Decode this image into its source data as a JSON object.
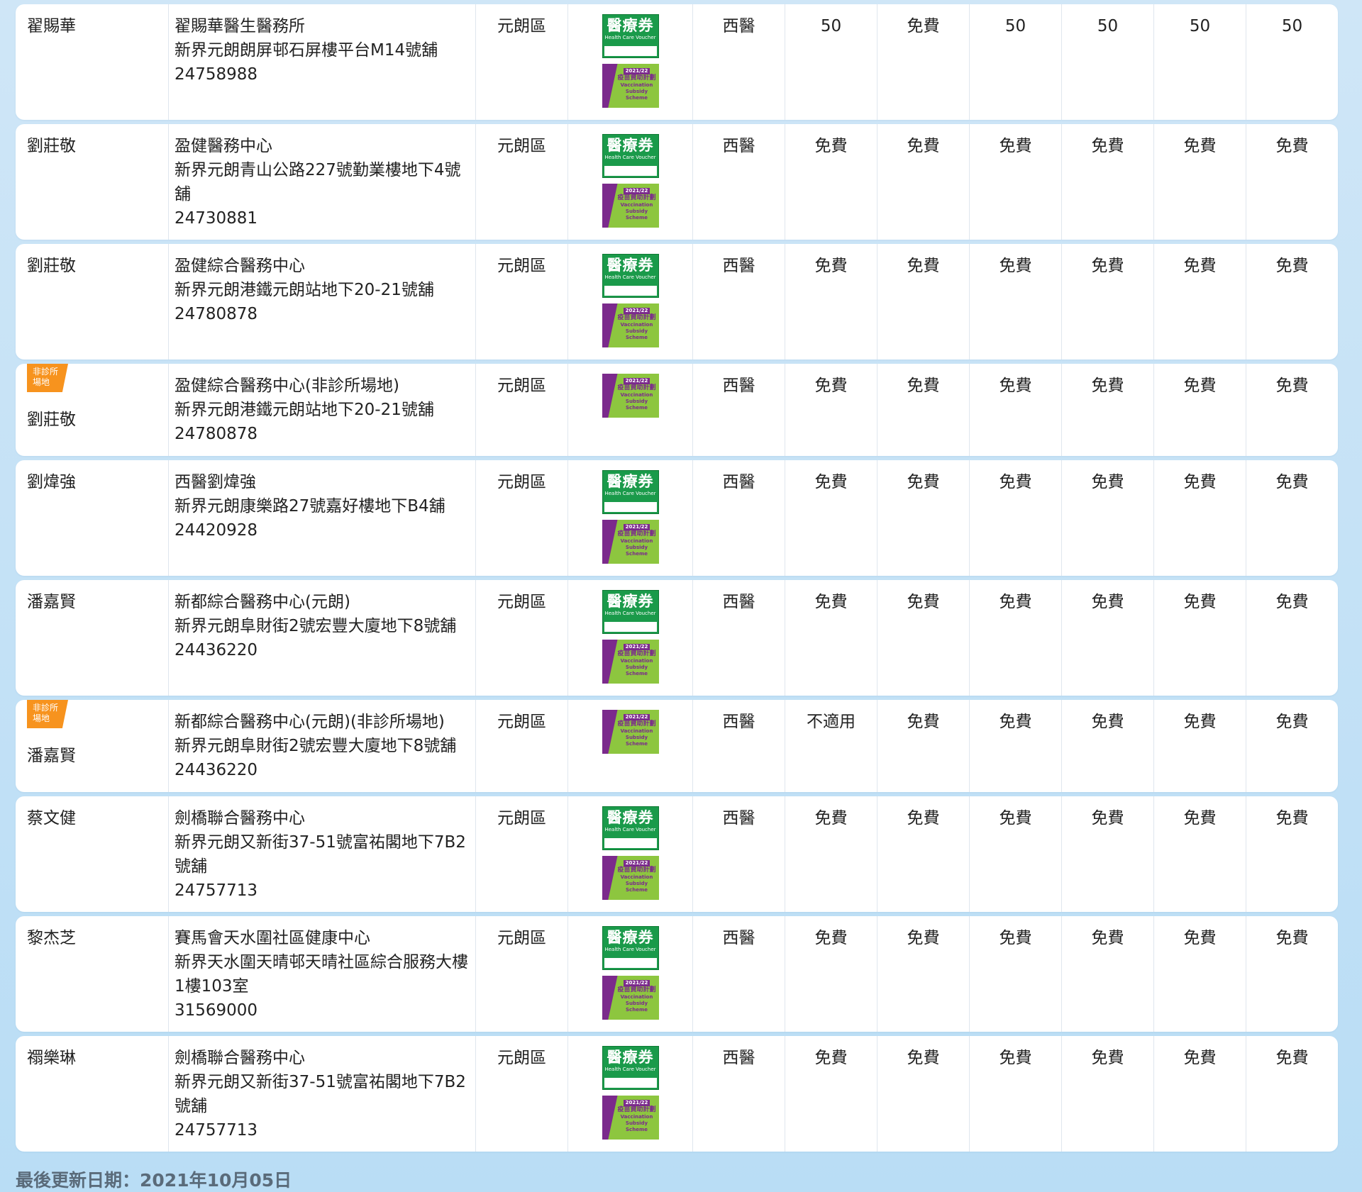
{
  "logos": {
    "hcv": {
      "name_zh": "醫療券",
      "name_en": "Health Care Voucher"
    },
    "vss": {
      "year": "2021/22",
      "name_zh": "疫苗資助計劃",
      "name_en": "Vaccination Subsidy Scheme"
    }
  },
  "tag": {
    "line1": "非診所",
    "line2": "場地"
  },
  "rows": [
    {
      "doctor": "翟賜華",
      "clinic": "翟賜華醫生醫務所",
      "address": "新界元朗朗屏邨石屏樓平台M14號舖",
      "phone": "24758988",
      "district": "元朗區",
      "type": "西醫",
      "fees": [
        "50",
        "免費",
        "50",
        "50",
        "50",
        "50"
      ]
    },
    {
      "doctor": "劉莊敬",
      "clinic": "盈健醫務中心",
      "address": "新界元朗青山公路227號勤業樓地下4號舖",
      "phone": "24730881",
      "district": "元朗區",
      "type": "西醫",
      "fees": [
        "免費",
        "免費",
        "免費",
        "免費",
        "免費",
        "免費"
      ]
    },
    {
      "doctor": "劉莊敬",
      "clinic": "盈健綜合醫務中心",
      "address": "新界元朗港鐵元朗站地下20-21號舖",
      "phone": "24780878",
      "district": "元朗區",
      "type": "西醫",
      "fees": [
        "免費",
        "免費",
        "免費",
        "免費",
        "免費",
        "免費"
      ]
    },
    {
      "doctor": "劉莊敬",
      "clinic": "盈健綜合醫務中心(非診所場地)",
      "address": "新界元朗港鐵元朗站地下20-21號舖",
      "phone": "24780878",
      "district": "元朗區",
      "type": "西醫",
      "fees": [
        "免費",
        "免費",
        "免費",
        "免費",
        "免費",
        "免費"
      ]
    },
    {
      "doctor": "劉煒強",
      "clinic": "西醫劉煒強",
      "address": "新界元朗康樂路27號嘉好樓地下B4舖",
      "phone": "24420928",
      "district": "元朗區",
      "type": "西醫",
      "fees": [
        "免費",
        "免費",
        "免費",
        "免費",
        "免費",
        "免費"
      ]
    },
    {
      "doctor": "潘嘉賢",
      "clinic": "新都綜合醫務中心(元朗)",
      "address": "新界元朗阜財街2號宏豐大廈地下8號舖",
      "phone": "24436220",
      "district": "元朗區",
      "type": "西醫",
      "fees": [
        "免費",
        "免費",
        "免費",
        "免費",
        "免費",
        "免費"
      ]
    },
    {
      "doctor": "潘嘉賢",
      "clinic": "新都綜合醫務中心(元朗)(非診所場地)",
      "address": "新界元朗阜財街2號宏豐大廈地下8號舖",
      "phone": "24436220",
      "district": "元朗區",
      "type": "西醫",
      "fees": [
        "不適用",
        "免費",
        "免費",
        "免費",
        "免費",
        "免費"
      ]
    },
    {
      "doctor": "蔡文健",
      "clinic": "劍橋聯合醫務中心",
      "address": "新界元朗又新街37-51號富祐閣地下7B2號舖",
      "phone": "24757713",
      "district": "元朗區",
      "type": "西醫",
      "fees": [
        "免費",
        "免費",
        "免費",
        "免費",
        "免費",
        "免費"
      ]
    },
    {
      "doctor": "黎杰芝",
      "clinic": "賽馬會天水圍社區健康中心",
      "address": "新界天水圍天晴邨天晴社區綜合服務大樓1樓103室",
      "phone": "31569000",
      "district": "元朗區",
      "type": "西醫",
      "fees": [
        "免費",
        "免費",
        "免費",
        "免費",
        "免費",
        "免費"
      ]
    },
    {
      "doctor": "禤樂琳",
      "clinic": "劍橋聯合醫務中心",
      "address": "新界元朗又新街37-51號富祐閣地下7B2號舖",
      "phone": "24757713",
      "district": "元朗區",
      "type": "西醫",
      "fees": [
        "免費",
        "免費",
        "免費",
        "免費",
        "免費",
        "免費"
      ]
    }
  ],
  "footer": {
    "last_updated": "最後更新日期：2021年10月05日"
  }
}
